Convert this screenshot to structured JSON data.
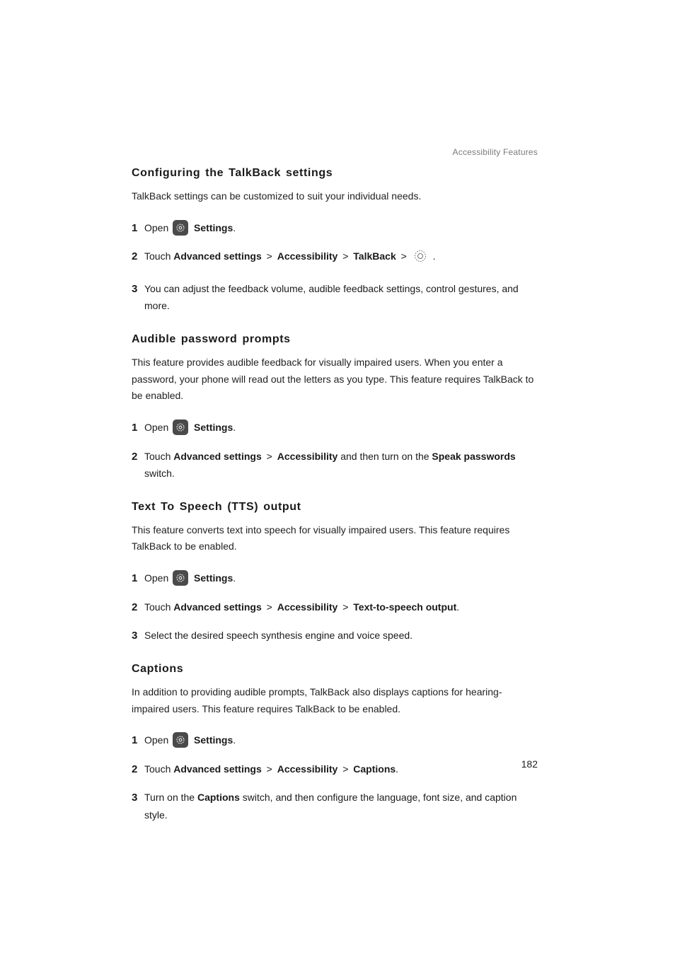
{
  "running_head": "Accessibility Features",
  "page_number": "182",
  "labels": {
    "open": "Open",
    "touch": "Touch",
    "settings": "Settings",
    "advanced_settings": "Advanced settings",
    "accessibility": "Accessibility",
    "talkback": "TalkBack",
    "text_to_speech_output": "Text-to-speech output",
    "captions_nav": "Captions",
    "speak_passwords": "Speak passwords",
    "captions_switch": "Captions",
    "sep": ">"
  },
  "text": {
    "and_then_turn_on": " and then turn on the ",
    "switch_period": " switch.",
    "turn_on_the": "Turn on the ",
    "captions_tail": " switch, and then configure the language, font size, and caption style."
  },
  "sections": [
    {
      "key": "configuring",
      "heading": "Configuring the TalkBack settings",
      "intro": "TalkBack settings can be customized to suit your individual needs.",
      "step3": "You can adjust the feedback volume, audible feedback settings, control gestures, and more."
    },
    {
      "key": "audible",
      "heading": "Audible password prompts",
      "intro": "This feature provides audible feedback for visually impaired users. When you enter a password, your phone will read out the letters as you type. This feature requires TalkBack to be enabled."
    },
    {
      "key": "tts",
      "heading": "Text To Speech (TTS) output",
      "intro": "This feature converts text into speech for visually impaired users. This feature requires TalkBack to be enabled.",
      "step3": "Select the desired speech synthesis engine and voice speed."
    },
    {
      "key": "captions",
      "heading": "Captions",
      "intro": "In addition to providing audible prompts, TalkBack also displays captions for hearing-impaired users. This feature requires TalkBack to be enabled."
    }
  ]
}
